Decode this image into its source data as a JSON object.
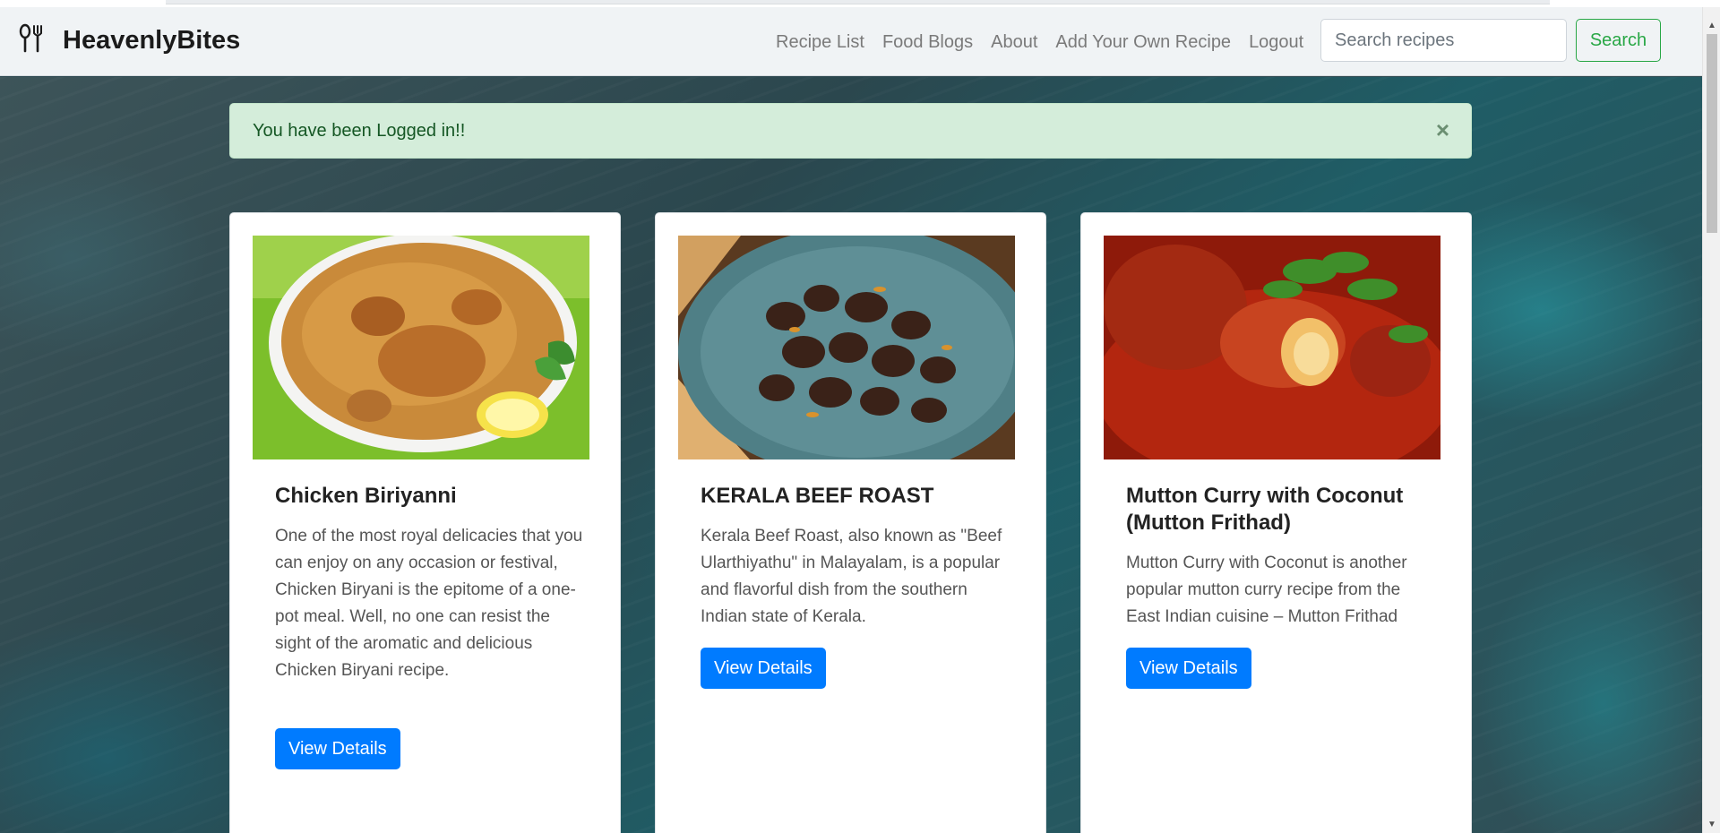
{
  "brand": {
    "name": "HeavenlyBites",
    "icon": "fork-spoon-icon"
  },
  "nav": {
    "links": [
      "Recipe List",
      "Food Blogs",
      "About",
      "Add Your Own Recipe",
      "Logout"
    ],
    "search_placeholder": "Search recipes",
    "search_button": "Search"
  },
  "alert": {
    "message": "You have been Logged in!!",
    "close_symbol": "×"
  },
  "cards": [
    {
      "title": "Chicken Biriyanni",
      "text": "One of the most royal delicacies that you can enjoy on any occasion or festival, Chicken Biryani is the epitome of a one-pot meal. Well, no one can resist the sight of the aromatic and delicious Chicken Biryani recipe.",
      "button": "View Details",
      "image": "chicken-biryani-photo"
    },
    {
      "title": "KERALA BEEF ROAST",
      "text": "Kerala Beef Roast, also known as \"Beef Ularthiyathu\" in Malayalam, is a popular and flavorful dish from the southern Indian state of Kerala.",
      "button": "View Details",
      "image": "beef-roast-photo"
    },
    {
      "title": "Mutton Curry with Coconut (Mutton Frithad)",
      "text": "Mutton Curry with Coconut is another popular mutton curry recipe from the East Indian cuisine – Mutton Frithad",
      "button": "View Details",
      "image": "mutton-curry-photo"
    }
  ],
  "colors": {
    "primary": "#007bff",
    "success": "#28a745",
    "alert_bg": "#d4edda",
    "alert_text": "#155724",
    "navbar_bg": "#f0f3f5"
  }
}
